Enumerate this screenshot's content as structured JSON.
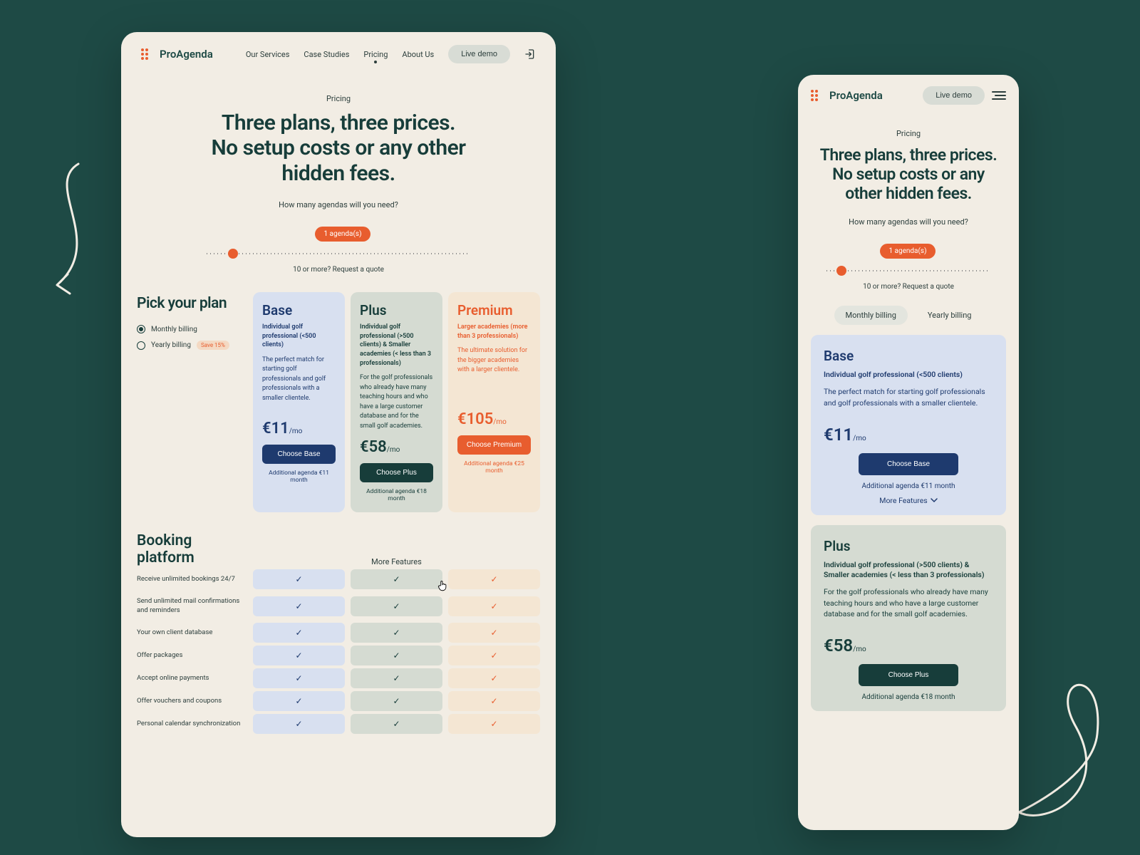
{
  "brand": "ProAgenda",
  "nav": {
    "items": [
      "Our Services",
      "Case Studies",
      "Pricing",
      "About Us"
    ],
    "activeIndex": 2,
    "demo": "Live demo"
  },
  "hero": {
    "eyebrow": "Pricing",
    "title_l1": "Three plans, three prices.",
    "title_l2": "No setup costs or any other",
    "title_l3": "hidden fees.",
    "m_title_l1": "Three plans, three prices.",
    "m_title_l2": "No setup costs or any",
    "m_title_l3": "other hidden fees.",
    "question": "How many agendas will you need?",
    "tooltip": "1 agenda(s)",
    "quote": "10 or more? Request a quote"
  },
  "pick": {
    "title": "Pick your plan",
    "monthly": "Monthly billing",
    "yearly": "Yearly billing",
    "save": "Save 15%"
  },
  "billtabs": {
    "monthly": "Monthly billing",
    "yearly": "Yearly billing"
  },
  "plans": {
    "base": {
      "name": "Base",
      "audience": "Individual golf professional (<500 clients)",
      "desc": "The perfect match for starting golf professionals and golf professionals with a smaller clientele.",
      "price": "€11",
      "per": "/mo",
      "cta": "Choose Base",
      "addl": "Additional agenda €11 month"
    },
    "plus": {
      "name": "Plus",
      "audience": "Individual golf professional (>500 clients) & Smaller academies (< less than 3 professionals)",
      "desc": "For the golf professionals who already have many teaching hours and who have a large customer database and for the small golf academies.",
      "price": "€58",
      "per": "/mo",
      "cta": "Choose Plus",
      "addl": "Additional agenda €18 month"
    },
    "premium": {
      "name": "Premium",
      "audience": "Larger academies (more than 3 professionals)",
      "desc": "The ultimate solution for the bigger academies with a larger clientele.",
      "price": "€105",
      "per": "/mo",
      "cta": "Choose Premium",
      "addl": "Additional agenda €25 month"
    }
  },
  "features": {
    "title": "Booking platform",
    "more": "More Features",
    "moreFeat": "More Features",
    "rows": [
      "Receive unlimited bookings 24/7",
      "Send unlimited mail confirmations and reminders",
      "Your own client database",
      "Offer packages",
      "Accept online payments",
      "Offer vouchers and coupons",
      "Personal calendar synchronization"
    ]
  }
}
